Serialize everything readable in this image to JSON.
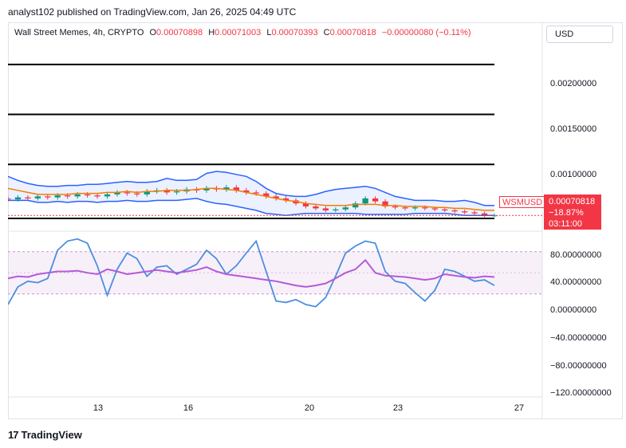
{
  "header": {
    "published": "analyst102 published on TradingView.com, Jan 26, 2025 04:49 UTC"
  },
  "legend": {
    "symbol": "Wall Street Memes, 4h, CRYPTO",
    "o_label": "O",
    "o_value": "0.00070898",
    "h_label": "H",
    "h_value": "0.00071003",
    "l_label": "L",
    "l_value": "0.00070393",
    "c_label": "C",
    "c_value": "0.00070818",
    "change": "−0.00000080 (−0.11%)"
  },
  "currency_button": "USD",
  "price_tag": {
    "symbol": "WSMUSD",
    "price": "0.00070818",
    "change_pct": "−18.87%",
    "countdown": "03:11:00"
  },
  "colors": {
    "down": "#f23645",
    "up": "#089981",
    "bollinger": "#2962ff",
    "basis": "#f57c00",
    "stoch_k": "#4a8ee0",
    "rsi": "#b35ad8"
  },
  "footer": {
    "brand": "TradingView"
  },
  "chart_data": [
    {
      "type": "candlestick",
      "ylim": [
        0.0006,
        0.00237
      ],
      "yticks": [
        "0.00200000",
        "0.00150000",
        "0.00100000"
      ],
      "xticks": [
        "13",
        "16",
        "20",
        "23",
        "27"
      ],
      "horizontal_levels": [
        0.00222,
        0.00172,
        0.00122,
        0.00068
      ],
      "close": [
        0.00087,
        0.00089,
        0.00088,
        0.0009,
        0.00089,
        0.00091,
        0.0009,
        0.00092,
        0.00091,
        0.0009,
        0.00092,
        0.00094,
        0.00093,
        0.00092,
        0.00095,
        0.00096,
        0.00094,
        0.00095,
        0.00097,
        0.00096,
        0.00098,
        0.00097,
        0.00099,
        0.00096,
        0.00094,
        0.00093,
        0.0009,
        0.00088,
        0.00086,
        0.00083,
        0.0008,
        0.00078,
        0.00076,
        0.00077,
        0.00079,
        0.00083,
        0.00088,
        0.00085,
        0.0008,
        0.00079,
        0.00078,
        0.00079,
        0.00078,
        0.00077,
        0.00076,
        0.00075,
        0.00074,
        0.00073,
        0.00071,
        0.00071
      ],
      "bollinger_upper": [
        0.0011,
        0.00106,
        0.00103,
        0.00101,
        0.001,
        0.001,
        0.00101,
        0.00101,
        0.00102,
        0.00102,
        0.00103,
        0.00104,
        0.00105,
        0.00104,
        0.00104,
        0.00105,
        0.00108,
        0.00106,
        0.00106,
        0.00107,
        0.00113,
        0.00115,
        0.00114,
        0.00112,
        0.0011,
        0.00105,
        0.00098,
        0.00093,
        0.00091,
        0.0009,
        0.0009,
        0.00092,
        0.00095,
        0.00097,
        0.00098,
        0.00099,
        0.001,
        0.00098,
        0.00094,
        0.0009,
        0.00088,
        0.00086,
        0.00086,
        0.00086,
        0.00085,
        0.00085,
        0.00086,
        0.00084,
        0.00081,
        0.00081
      ],
      "bollinger_basis": [
        0.00098,
        0.00096,
        0.00094,
        0.00092,
        0.00092,
        0.00092,
        0.00092,
        0.00093,
        0.00093,
        0.00093,
        0.00094,
        0.00094,
        0.00095,
        0.00094,
        0.00095,
        0.00095,
        0.00096,
        0.00096,
        0.00096,
        0.00097,
        0.00098,
        0.00098,
        0.00097,
        0.00096,
        0.00094,
        0.00092,
        0.0009,
        0.00088,
        0.00086,
        0.00085,
        0.00083,
        0.00082,
        0.00081,
        0.00081,
        0.00081,
        0.00082,
        0.00082,
        0.00082,
        0.00081,
        0.00081,
        0.0008,
        0.0008,
        0.0008,
        0.00079,
        0.00079,
        0.00078,
        0.00078,
        0.00077,
        0.00076,
        0.00076
      ],
      "bollinger_lower": [
        0.00086,
        0.00086,
        0.00086,
        0.00084,
        0.00084,
        0.00085,
        0.00084,
        0.00085,
        0.00085,
        0.00084,
        0.00085,
        0.00085,
        0.00086,
        0.00085,
        0.00085,
        0.00086,
        0.00086,
        0.00086,
        0.00087,
        0.00088,
        0.00085,
        0.00083,
        0.00082,
        0.0008,
        0.00078,
        0.00076,
        0.00073,
        0.00072,
        0.00071,
        0.00072,
        0.00073,
        0.00073,
        0.00073,
        0.00073,
        0.00073,
        0.00073,
        0.00072,
        0.00072,
        0.00072,
        0.00072,
        0.00072,
        0.00073,
        0.00073,
        0.00073,
        0.00073,
        0.00072,
        0.00071,
        0.00071,
        0.00071,
        0.00071
      ]
    },
    {
      "type": "line",
      "ylim": [
        -125,
        100
      ],
      "yticks": [
        "80.00000000",
        "40.00000000",
        "0.00000000",
        "−40.00000000",
        "−80.00000000",
        "−120.00000000"
      ],
      "band": [
        20,
        80
      ],
      "series": [
        {
          "values": [
            5,
            30,
            38,
            36,
            42,
            82,
            95,
            98,
            92,
            60,
            18,
            55,
            78,
            70,
            45,
            58,
            60,
            48,
            55,
            62,
            82,
            70,
            48,
            60,
            78,
            95,
            52,
            10,
            8,
            12,
            5,
            2,
            15,
            45,
            78,
            88,
            95,
            92,
            52,
            38,
            35,
            22,
            10,
            25,
            55,
            52,
            45,
            38,
            40,
            32
          ]
        },
        {
          "values": [
            42,
            45,
            44,
            48,
            50,
            52,
            52,
            53,
            50,
            48,
            55,
            52,
            48,
            50,
            52,
            54,
            52,
            50,
            52,
            54,
            58,
            52,
            48,
            46,
            44,
            42,
            40,
            38,
            35,
            32,
            30,
            32,
            35,
            42,
            50,
            55,
            68,
            50,
            46,
            45,
            44,
            42,
            40,
            42,
            48,
            46,
            44,
            43,
            45,
            44
          ]
        }
      ]
    }
  ]
}
